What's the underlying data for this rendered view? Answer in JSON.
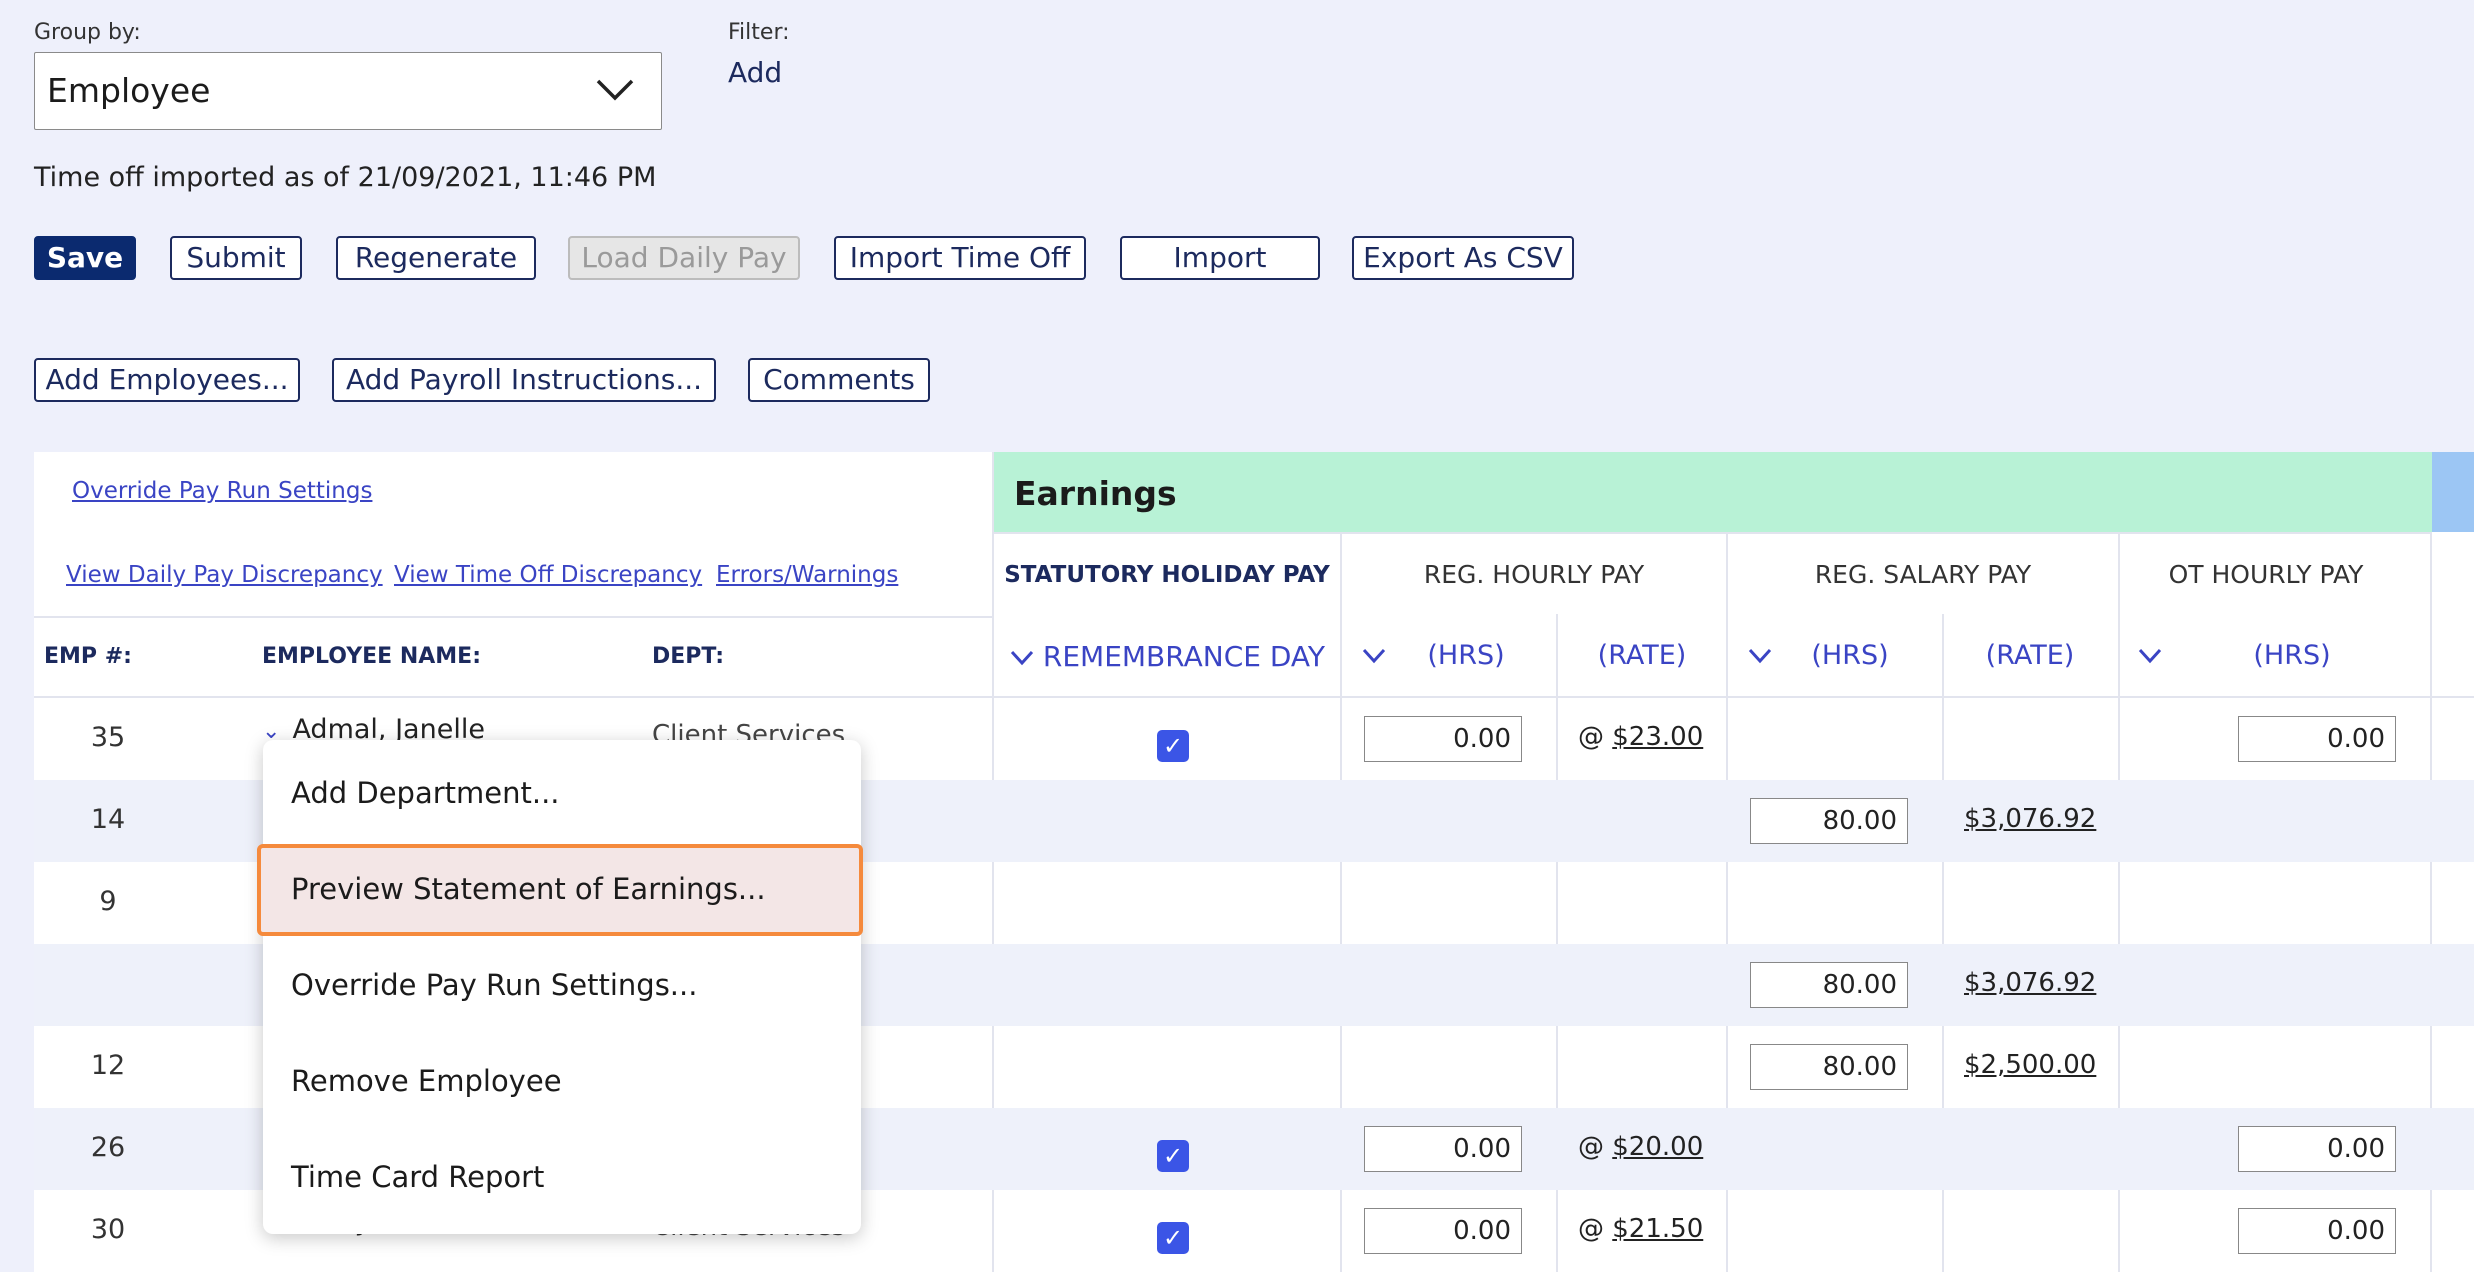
{
  "group_by": {
    "label": "Group by:",
    "value": "Employee"
  },
  "filter": {
    "label": "Filter:",
    "add": "Add"
  },
  "time_off_status": "Time off imported as of 21/09/2021, 11:46 PM",
  "toolbar1": {
    "save": "Save",
    "submit": "Submit",
    "regenerate": "Regenerate",
    "load_daily_pay": "Load Daily Pay",
    "import_time_off": "Import Time Off",
    "import": "Import",
    "export_csv": "Export As CSV"
  },
  "toolbar2": {
    "add_employees": "Add Employees...",
    "add_payroll_instructions": "Add Payroll Instructions...",
    "comments": "Comments"
  },
  "links": {
    "override": "Override Pay Run Settings",
    "daily_pay_discrepancy": "View Daily Pay Discrepancy",
    "time_off_discrepancy": "View Time Off Discrepancy",
    "errors_warnings": "Errors/Warnings"
  },
  "grid": {
    "earnings_title": "Earnings",
    "cols": {
      "stat_holiday": "STATUTORY HOLIDAY PAY",
      "reg_hourly": "REG. HOURLY PAY",
      "reg_salary": "REG. SALARY PAY",
      "ot_hourly": "OT HOURLY PAY"
    },
    "subcols": {
      "remembrance": "REMEMBRANCE DAY",
      "hrs": "(HRS)",
      "rate": "(RATE)"
    },
    "emp_cols": {
      "num": "EMP #:",
      "name": "EMPLOYEE NAME:",
      "dept": "DEPT:"
    }
  },
  "rows": [
    {
      "num": "35",
      "name": "Admal, Janelle",
      "dept": "Client Services",
      "check": true,
      "reg_hrs": "0.00",
      "reg_rate": "$23.00",
      "sal_hrs": "",
      "sal_rate": "",
      "ot_hrs": "0.00"
    },
    {
      "num": "14",
      "name": "",
      "dept": "",
      "check": false,
      "reg_hrs": "",
      "reg_rate": "",
      "sal_hrs": "80.00",
      "sal_rate": "$3,076.92",
      "ot_hrs": ""
    },
    {
      "num": "9",
      "name": "",
      "dept": "",
      "check": false,
      "reg_hrs": "",
      "reg_rate": "",
      "sal_hrs": "",
      "sal_rate": "",
      "ot_hrs": ""
    },
    {
      "num": "",
      "name": "",
      "dept": "",
      "check": false,
      "reg_hrs": "",
      "reg_rate": "",
      "sal_hrs": "80.00",
      "sal_rate": "$3,076.92",
      "ot_hrs": ""
    },
    {
      "num": "12",
      "name": "",
      "dept": "",
      "check": false,
      "reg_hrs": "",
      "reg_rate": "",
      "sal_hrs": "80.00",
      "sal_rate": "$2,500.00",
      "ot_hrs": ""
    },
    {
      "num": "26",
      "name": "",
      "dept": "",
      "check": true,
      "reg_hrs": "0.00",
      "reg_rate": "$20.00",
      "sal_hrs": "",
      "sal_rate": "",
      "ot_hrs": "0.00"
    },
    {
      "num": "30",
      "name": "Lau, Jamie",
      "dept": "Client Services",
      "check": true,
      "reg_hrs": "0.00",
      "reg_rate": "$21.50",
      "sal_hrs": "",
      "sal_rate": "",
      "ot_hrs": "0.00"
    }
  ],
  "context_menu": {
    "items": [
      "Add Department...",
      "Preview Statement of Earnings...",
      "Override Pay Run Settings...",
      "Remove Employee",
      "Time Card Report"
    ]
  }
}
